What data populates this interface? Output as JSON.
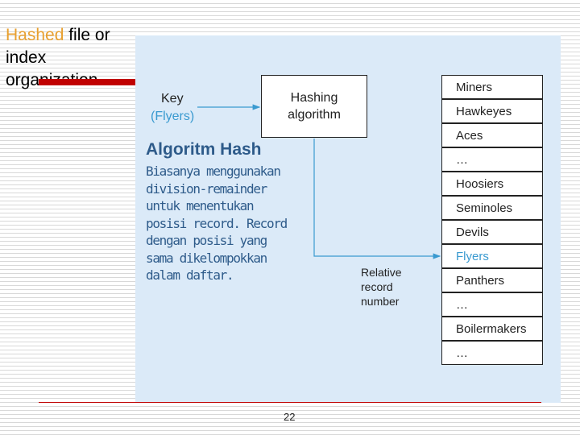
{
  "title": {
    "highlight": "Hashed",
    "rest1": " file or",
    "line2": "index",
    "line3": "organization"
  },
  "diagram": {
    "key_label": "Key",
    "key_value": "(Flyers)",
    "hash_box": [
      "Hashing",
      "algorithm"
    ],
    "relative_label": [
      "Relative",
      "record",
      "number"
    ],
    "records": [
      "Miners",
      "Hawkeyes",
      "Aces",
      "…",
      "Hoosiers",
      "Seminoles",
      "Devils",
      "Flyers",
      "Panthers",
      "…",
      "Boilermakers",
      "…"
    ],
    "highlighted_record": "Flyers",
    "highlight_color": "#3a9ad0"
  },
  "overlay": {
    "heading": "Algoritm Hash",
    "body": "Biasanya menggunakan division-remainder untuk menentukan posisi record. Record dengan posisi yang sama dikelompokkan dalam daftar."
  },
  "page_number": "22"
}
